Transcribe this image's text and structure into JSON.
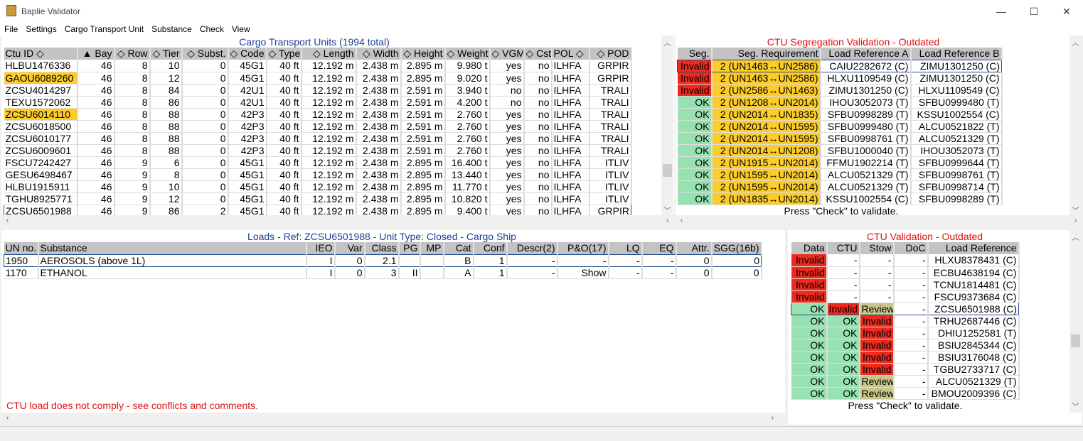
{
  "window": {
    "title": "Baplie Validator",
    "minimize": "—",
    "maximize": "☐",
    "close": "✕"
  },
  "menu": [
    "File",
    "Settings",
    "Cargo Transport Unit",
    "Substance",
    "Check",
    "View"
  ],
  "colors": {
    "invalid": "#ee2a1e",
    "ok": "#98e2b2",
    "review": "#c6c68a",
    "highlight": "#fccc2a",
    "title_blue": "#1d3f94",
    "title_red": "#e01010"
  },
  "ctu": {
    "title": "Cargo Transport Units (1994 total)",
    "columns": [
      "Ctu ID ◇",
      "▲ Bay",
      "◇ Row",
      "◇ Tier",
      "◇ Subst.",
      "◇ Code",
      "◇ Type",
      "◇ Length",
      "◇ Width",
      "◇ Height",
      "◇ Weight",
      "◇ VGM",
      "◇ Cst",
      "POL ◇",
      "◇ POD"
    ],
    "rows": [
      {
        "cells": [
          "HLBU1476336",
          "46",
          "8",
          "10",
          "0",
          "45G1",
          "40 ft",
          "12.192 m",
          "2.438 m",
          "2.895 m",
          "9.980 t",
          "yes",
          "no",
          "ILHFA",
          "GRPIR"
        ]
      },
      {
        "hl": true,
        "cells": [
          "GAOU6089260",
          "46",
          "8",
          "12",
          "0",
          "45G1",
          "40 ft",
          "12.192 m",
          "2.438 m",
          "2.895 m",
          "9.020 t",
          "yes",
          "no",
          "ILHFA",
          "GRPIR"
        ]
      },
      {
        "cells": [
          "ZCSU4014297",
          "46",
          "8",
          "84",
          "0",
          "42U1",
          "40 ft",
          "12.192 m",
          "2.438 m",
          "2.591 m",
          "3.940 t",
          "no",
          "no",
          "ILHFA",
          "TRALI"
        ]
      },
      {
        "cells": [
          "TEXU1572062",
          "46",
          "8",
          "86",
          "0",
          "42U1",
          "40 ft",
          "12.192 m",
          "2.438 m",
          "2.591 m",
          "4.200 t",
          "no",
          "no",
          "ILHFA",
          "TRALI"
        ]
      },
      {
        "hl": true,
        "cells": [
          "ZCSU6014110",
          "46",
          "8",
          "88",
          "0",
          "42P3",
          "40 ft",
          "12.192 m",
          "2.438 m",
          "2.591 m",
          "2.760 t",
          "yes",
          "no",
          "ILHFA",
          "TRALI"
        ]
      },
      {
        "cells": [
          "ZCSU6018500",
          "46",
          "8",
          "88",
          "0",
          "42P3",
          "40 ft",
          "12.192 m",
          "2.438 m",
          "2.591 m",
          "2.760 t",
          "yes",
          "no",
          "ILHFA",
          "TRALI"
        ]
      },
      {
        "cells": [
          "ZCSU6010177",
          "46",
          "8",
          "88",
          "0",
          "42P3",
          "40 ft",
          "12.192 m",
          "2.438 m",
          "2.591 m",
          "2.760 t",
          "yes",
          "no",
          "ILHFA",
          "TRALI"
        ]
      },
      {
        "cells": [
          "ZCSU6009601",
          "46",
          "8",
          "88",
          "0",
          "42P3",
          "40 ft",
          "12.192 m",
          "2.438 m",
          "2.591 m",
          "2.760 t",
          "yes",
          "no",
          "ILHFA",
          "TRALI"
        ]
      },
      {
        "cells": [
          "FSCU7242427",
          "46",
          "9",
          "6",
          "0",
          "45G1",
          "40 ft",
          "12.192 m",
          "2.438 m",
          "2.895 m",
          "16.400 t",
          "yes",
          "no",
          "ILHFA",
          "ITLIV"
        ]
      },
      {
        "cells": [
          "GESU6498467",
          "46",
          "9",
          "8",
          "0",
          "45G1",
          "40 ft",
          "12.192 m",
          "2.438 m",
          "2.895 m",
          "13.440 t",
          "yes",
          "no",
          "ILHFA",
          "ITLIV"
        ]
      },
      {
        "cells": [
          "HLBU1915911",
          "46",
          "9",
          "10",
          "0",
          "45G1",
          "40 ft",
          "12.192 m",
          "2.438 m",
          "2.895 m",
          "11.770 t",
          "yes",
          "no",
          "ILHFA",
          "ITLIV"
        ]
      },
      {
        "cells": [
          "TGHU8925771",
          "46",
          "9",
          "12",
          "0",
          "45G1",
          "40 ft",
          "12.192 m",
          "2.438 m",
          "2.895 m",
          "10.820 t",
          "yes",
          "no",
          "ILHFA",
          "ITLIV"
        ]
      },
      {
        "sel": true,
        "cells": [
          "ZCSU6501988",
          "46",
          "9",
          "86",
          "2",
          "45G1",
          "40 ft",
          "12.192 m",
          "2.438 m",
          "2.895 m",
          "9.400 t",
          "yes",
          "no",
          "ILHFA",
          "GRPIR"
        ]
      }
    ]
  },
  "segregation": {
    "title": "CTU Segregation Validation - Outdated",
    "columns": [
      "Seg.",
      "Seg. Requirement",
      "Load Reference A",
      "Load Reference B"
    ],
    "rows": [
      {
        "sel": true,
        "cells": [
          "Invalid",
          "2 (UN1463↔UN2586)",
          "CAIU2282672 (C)",
          "ZIMU1301250 (C)"
        ]
      },
      {
        "cells": [
          "Invalid",
          "2 (UN1463↔UN2586)",
          "HLXU1109549 (C)",
          "ZIMU1301250 (C)"
        ]
      },
      {
        "cells": [
          "Invalid",
          "2 (UN2586↔UN1463)",
          "ZIMU1301250 (C)",
          "HLXU1109549 (C)"
        ]
      },
      {
        "cells": [
          "OK",
          "2 (UN1208↔UN2014)",
          "IHOU3052073 (T)",
          "SFBU0999480 (T)"
        ]
      },
      {
        "cells": [
          "OK",
          "2 (UN2014↔UN1835)",
          "SFBU0998289 (T)",
          "KSSU1002554 (C)"
        ]
      },
      {
        "cells": [
          "OK",
          "2 (UN2014↔UN1595)",
          "SFBU0999480 (T)",
          "ALCU0521822 (T)"
        ]
      },
      {
        "cells": [
          "OK",
          "2 (UN2014↔UN1595)",
          "SFBU0998761 (T)",
          "ALCU0521329 (T)"
        ]
      },
      {
        "cells": [
          "OK",
          "2 (UN2014↔UN1208)",
          "SFBU1000040 (T)",
          "IHOU3052073 (T)"
        ]
      },
      {
        "cells": [
          "OK",
          "2 (UN1915↔UN2014)",
          "FFMU1902214 (T)",
          "SFBU0999644 (T)"
        ]
      },
      {
        "cells": [
          "OK",
          "2 (UN1595↔UN2014)",
          "ALCU0521329 (T)",
          "SFBU0998761 (T)"
        ]
      },
      {
        "cells": [
          "OK",
          "2 (UN1595↔UN2014)",
          "ALCU0521329 (T)",
          "SFBU0998714 (T)"
        ]
      },
      {
        "cells": [
          "OK",
          "2 (UN1835↔UN2014)",
          "KSSU1002554 (C)",
          "SFBU0998289 (T)"
        ]
      }
    ],
    "footer": "Press \"Check\" to validate."
  },
  "loads": {
    "title": "Loads - Ref: ZCSU6501988 - Unit Type: Closed - Cargo Ship",
    "columns": [
      "UN no.",
      "Substance",
      "IEO",
      "Var",
      "Class",
      "PG",
      "MP",
      "Cat",
      "Conf",
      "Descr(2)",
      "P&O(17)",
      "LQ",
      "EQ",
      "Attr.",
      "SGG(16b)"
    ],
    "rows": [
      {
        "sel": true,
        "cells": [
          "1950",
          "AEROSOLS (above 1L)",
          "I",
          "0",
          "2.1",
          "",
          "",
          "B",
          "1",
          "-",
          "-",
          "-",
          "-",
          "0",
          "0"
        ]
      },
      {
        "cells": [
          "1170",
          "ETHANOL",
          "I",
          "0",
          "3",
          "II",
          "",
          "A",
          "1",
          "-",
          "Show",
          "-",
          "-",
          "0",
          "0"
        ]
      }
    ],
    "message": "CTU load does not comply - see conflicts and comments."
  },
  "validation": {
    "title": "CTU Validation - Outdated",
    "columns": [
      "Data",
      "CTU",
      "Stow",
      "DoC",
      "Load Reference"
    ],
    "rows": [
      {
        "cells": [
          "Invalid",
          "-",
          "-",
          "-",
          "HLXU8378431 (C)"
        ]
      },
      {
        "cells": [
          "Invalid",
          "-",
          "-",
          "-",
          "ECBU4638194 (C)"
        ]
      },
      {
        "cells": [
          "Invalid",
          "-",
          "-",
          "-",
          "TCNU1814481 (C)"
        ]
      },
      {
        "cells": [
          "Invalid",
          "-",
          "-",
          "-",
          "FSCU9373684 (C)"
        ]
      },
      {
        "sel": true,
        "cells": [
          "OK",
          "Invalid",
          "Review",
          "-",
          "ZCSU6501988 (C)"
        ]
      },
      {
        "cells": [
          "OK",
          "OK",
          "Invalid",
          "-",
          "TRHU2687446 (C)"
        ]
      },
      {
        "cells": [
          "OK",
          "OK",
          "Invalid",
          "-",
          "DHIU1252581 (T)"
        ]
      },
      {
        "cells": [
          "OK",
          "OK",
          "Invalid",
          "-",
          "BSIU2845344 (C)"
        ]
      },
      {
        "cells": [
          "OK",
          "OK",
          "Invalid",
          "-",
          "BSIU3176048 (C)"
        ]
      },
      {
        "cells": [
          "OK",
          "OK",
          "Invalid",
          "-",
          "TGBU2733717 (C)"
        ]
      },
      {
        "cells": [
          "OK",
          "OK",
          "Review",
          "-",
          "ALCU0521329 (T)"
        ]
      },
      {
        "cells": [
          "OK",
          "OK",
          "Review",
          "-",
          "BMOU2009396 (C)"
        ]
      }
    ],
    "footer": "Press \"Check\" to validate."
  }
}
